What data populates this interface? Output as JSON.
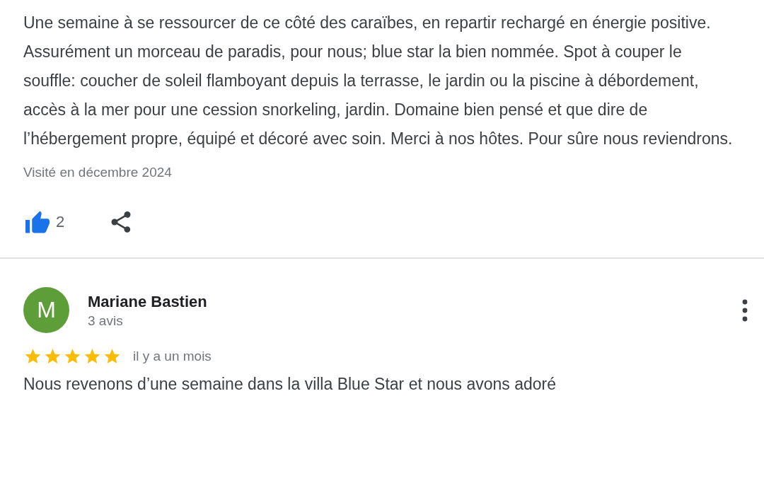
{
  "reviews": [
    {
      "text": "Une semaine à se ressourcer de ce côté des caraïbes, en repartir rechargé en énergie positive. Assurément un morceau de paradis, pour nous; blue star la bien nommée. Spot à couper le souffle: coucher de soleil flamboyant depuis la terrasse, le jardin ou la piscine à débordement, accès à la mer pour une cession snorkeling, jardin. Domaine bien pensé et que dire de l’hébergement propre, équipé et décoré avec soin. Merci à nos hôtes. Pour sûre nous reviendrons.",
      "visited": "Visité en décembre 2024",
      "likes": "2",
      "liked": true
    },
    {
      "initial": "M",
      "author": "Mariane Bastien",
      "count": "3 avis",
      "stars": 5,
      "date": "il y a un mois",
      "text": "Nous revenons d’une semaine dans la villa Blue Star et nous avons adoré"
    }
  ]
}
